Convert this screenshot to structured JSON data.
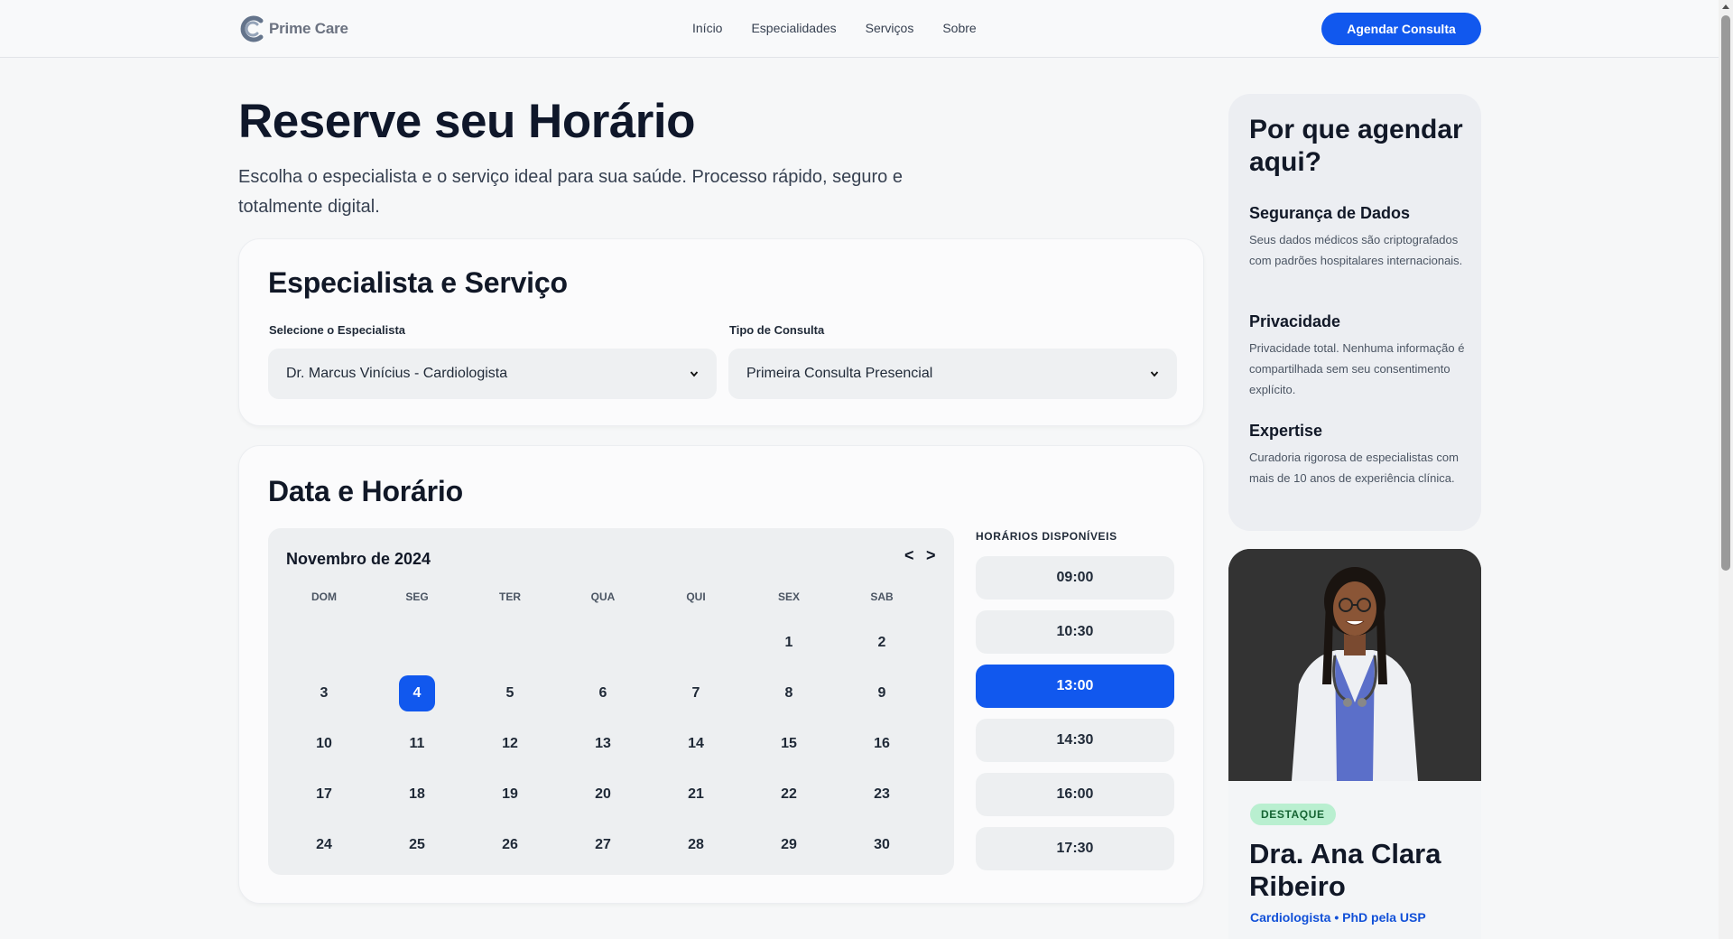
{
  "header": {
    "brand": "Prime Care",
    "nav": [
      "Início",
      "Especialidades",
      "Serviços",
      "Sobre"
    ],
    "cta": "Agendar Consulta"
  },
  "hero": {
    "title": "Reserve seu Horário",
    "subtitle": "Escolha o especialista e o serviço ideal para sua saúde. Processo rápido, seguro e totalmente digital."
  },
  "specialist_card": {
    "title": "Especialista e Serviço",
    "specialist_label": "Selecione o Especialista",
    "specialist_value": "Dr. Marcus Vinícius - Cardiologista",
    "type_label": "Tipo de Consulta",
    "type_value": "Primeira Consulta Presencial"
  },
  "datetime_card": {
    "title": "Data e Horário",
    "calendar": {
      "month": "Novembro de 2024",
      "prev": "<",
      "next": ">",
      "weekdays": [
        "DOM",
        "SEG",
        "TER",
        "QUA",
        "QUI",
        "SEX",
        "SAB"
      ],
      "first_weekday_index": 5,
      "days_in_month": 30,
      "selected_day": 4
    },
    "times_label": "HORÁRIOS DISPONÍVEIS",
    "times": [
      "09:00",
      "10:30",
      "13:00",
      "14:30",
      "16:00",
      "17:30"
    ],
    "selected_time": "13:00"
  },
  "sidebar": {
    "title": "Por que agendar aqui?",
    "items": [
      {
        "heading": "Segurança de Dados",
        "text": "Seus dados médicos são criptografados com padrões hospitalares internacionais."
      },
      {
        "heading": "Privacidade",
        "text": "Privacidade total. Nenhuma informação é compartilhada sem seu consentimento explícito."
      },
      {
        "heading": "Expertise",
        "text": "Curadoria rigorosa de especialistas com mais de 10 anos de experiência clínica."
      }
    ]
  },
  "featured_doctor": {
    "badge": "DESTAQUE",
    "name": "Dra. Ana Clara Ribeiro",
    "specialty": "Cardiologista • PhD pela USP"
  },
  "colors": {
    "accent": "#1158ee",
    "badge_bg": "#b9efd0"
  }
}
